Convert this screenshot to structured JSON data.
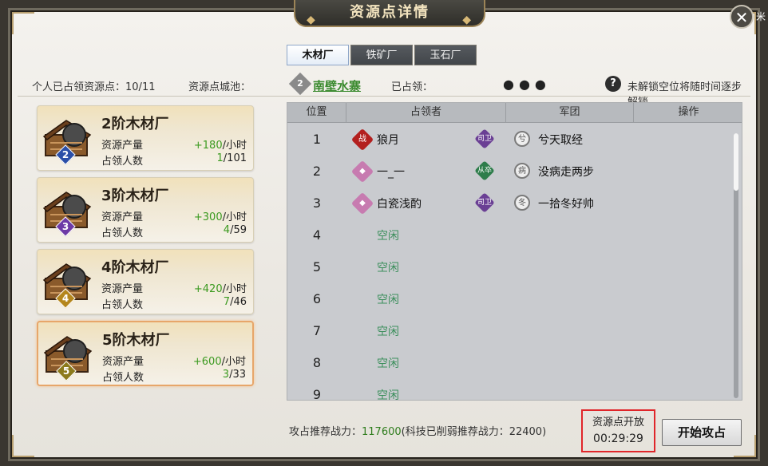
{
  "window": {
    "title": "资源点详情",
    "close_glyph": "✕",
    "corner_char": "米"
  },
  "tabs": [
    {
      "label": "木材厂",
      "active": true
    },
    {
      "label": "铁矿厂",
      "active": false
    },
    {
      "label": "玉石厂",
      "active": false
    }
  ],
  "info": {
    "occupied_label": "个人已占领资源点：",
    "occupied_value": "10/11",
    "city_label": "资源点城池：",
    "city_badge": "2",
    "city_name": "南壁水寨",
    "taken_label": "已占领：",
    "taken_dots": "●●●",
    "help_glyph": "?",
    "help_text": "未解锁空位将随时间逐步解锁"
  },
  "mills": [
    {
      "name": "2阶木材厂",
      "tier": "2",
      "tier_color": "#2b4fa8",
      "prod_label": "资源产量",
      "prod_value": "+180",
      "prod_unit": "/小时",
      "occ_label": "占领人数",
      "occ_value": "1",
      "occ_total": "/101",
      "selected": false
    },
    {
      "name": "3阶木材厂",
      "tier": "3",
      "tier_color": "#6d3aa6",
      "prod_label": "资源产量",
      "prod_value": "+300",
      "prod_unit": "/小时",
      "occ_label": "占领人数",
      "occ_value": "4",
      "occ_total": "/59",
      "selected": false
    },
    {
      "name": "4阶木材厂",
      "tier": "4",
      "tier_color": "#b4861c",
      "prod_label": "资源产量",
      "prod_value": "+420",
      "prod_unit": "/小时",
      "occ_label": "占领人数",
      "occ_value": "7",
      "occ_total": "/46",
      "selected": false
    },
    {
      "name": "5阶木材厂",
      "tier": "5",
      "tier_color": "#8c7a1c",
      "prod_label": "资源产量",
      "prod_value": "+600",
      "prod_unit": "/小时",
      "occ_label": "占领人数",
      "occ_value": "3",
      "occ_total": "/33",
      "selected": true
    }
  ],
  "table": {
    "headers": [
      "位置",
      "占领者",
      "军团",
      "操作"
    ],
    "rows": [
      {
        "pos": "1",
        "occupant": "狼月",
        "rank_glyph": "战",
        "rank_color": "#b3201f",
        "guild_glyph": "司卫",
        "guild_color": "#6a3f94",
        "alliance_glyph": "兮",
        "alliance": "兮天取经",
        "idle": ""
      },
      {
        "pos": "2",
        "occupant": "一_一",
        "rank_glyph": "◆",
        "rank_color": "#c77bb0",
        "guild_glyph": "从卒",
        "guild_color": "#2e7d4b",
        "alliance_glyph": "病",
        "alliance": "没病走两步",
        "idle": ""
      },
      {
        "pos": "3",
        "occupant": "白瓷浅酌",
        "rank_glyph": "◆",
        "rank_color": "#c77bb0",
        "guild_glyph": "司卫",
        "guild_color": "#6a3f94",
        "alliance_glyph": "冬",
        "alliance": "一拾冬好帅",
        "idle": ""
      },
      {
        "pos": "4",
        "idle": "空闲"
      },
      {
        "pos": "5",
        "idle": "空闲"
      },
      {
        "pos": "6",
        "idle": "空闲"
      },
      {
        "pos": "7",
        "idle": "空闲"
      },
      {
        "pos": "8",
        "idle": "空闲"
      },
      {
        "pos": "9",
        "idle": "空闲"
      }
    ]
  },
  "footer": {
    "power_label": "攻占推荐战力：",
    "power_value": "117600",
    "power_note": "(科技已削弱推荐战力：22400)",
    "timer_label": "资源点开放",
    "timer_value": "00:29:29",
    "start_button": "开始攻占"
  }
}
